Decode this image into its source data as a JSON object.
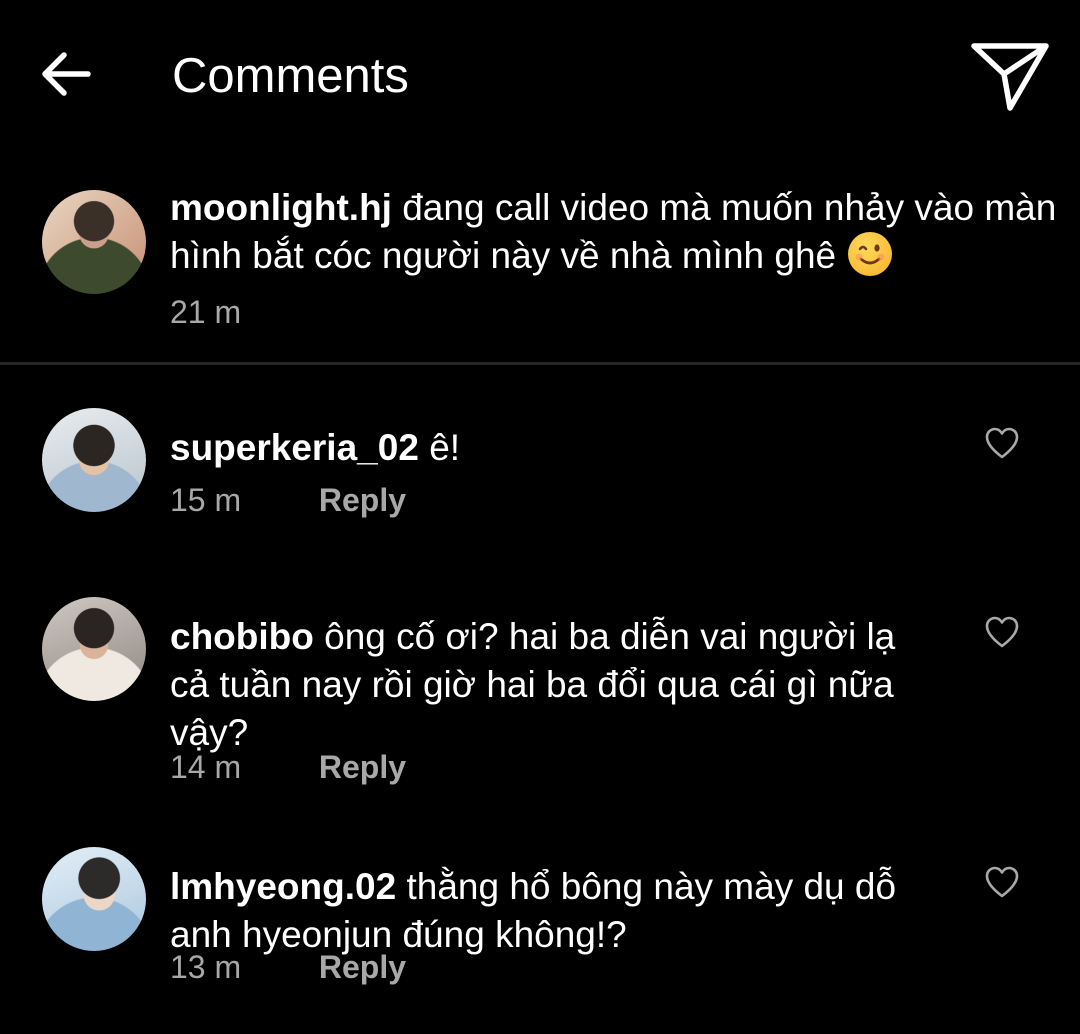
{
  "header": {
    "title": "Comments",
    "back_icon": "arrow-left-icon",
    "share_icon": "paper-plane-icon"
  },
  "caption": {
    "username": "moonlight.hj",
    "text": "đang call video mà muốn nhảy vào màn hình bắt cóc người này về nhà mình ghê",
    "emoji": "winking-face",
    "time": "21 m"
  },
  "comments": [
    {
      "username": "superkeria_02",
      "text": "ê!",
      "time": "15 m",
      "reply_label": "Reply"
    },
    {
      "username": "chobibo",
      "text": "ông cố ơi? hai ba diễn vai người lạ cả tuần nay rồi giờ hai ba đổi qua cái gì nữa vậy?",
      "time": "14 m",
      "reply_label": "Reply"
    },
    {
      "username": "lmhyeong.02",
      "text": "thằng hổ bông này mày dụ dỗ anh hyeonjun đúng không!?",
      "time": "13 m",
      "reply_label": "Reply"
    }
  ],
  "colors": {
    "background": "#000000",
    "text": "#ffffff",
    "secondary_text": "#a8a8a8",
    "divider": "#262626"
  }
}
